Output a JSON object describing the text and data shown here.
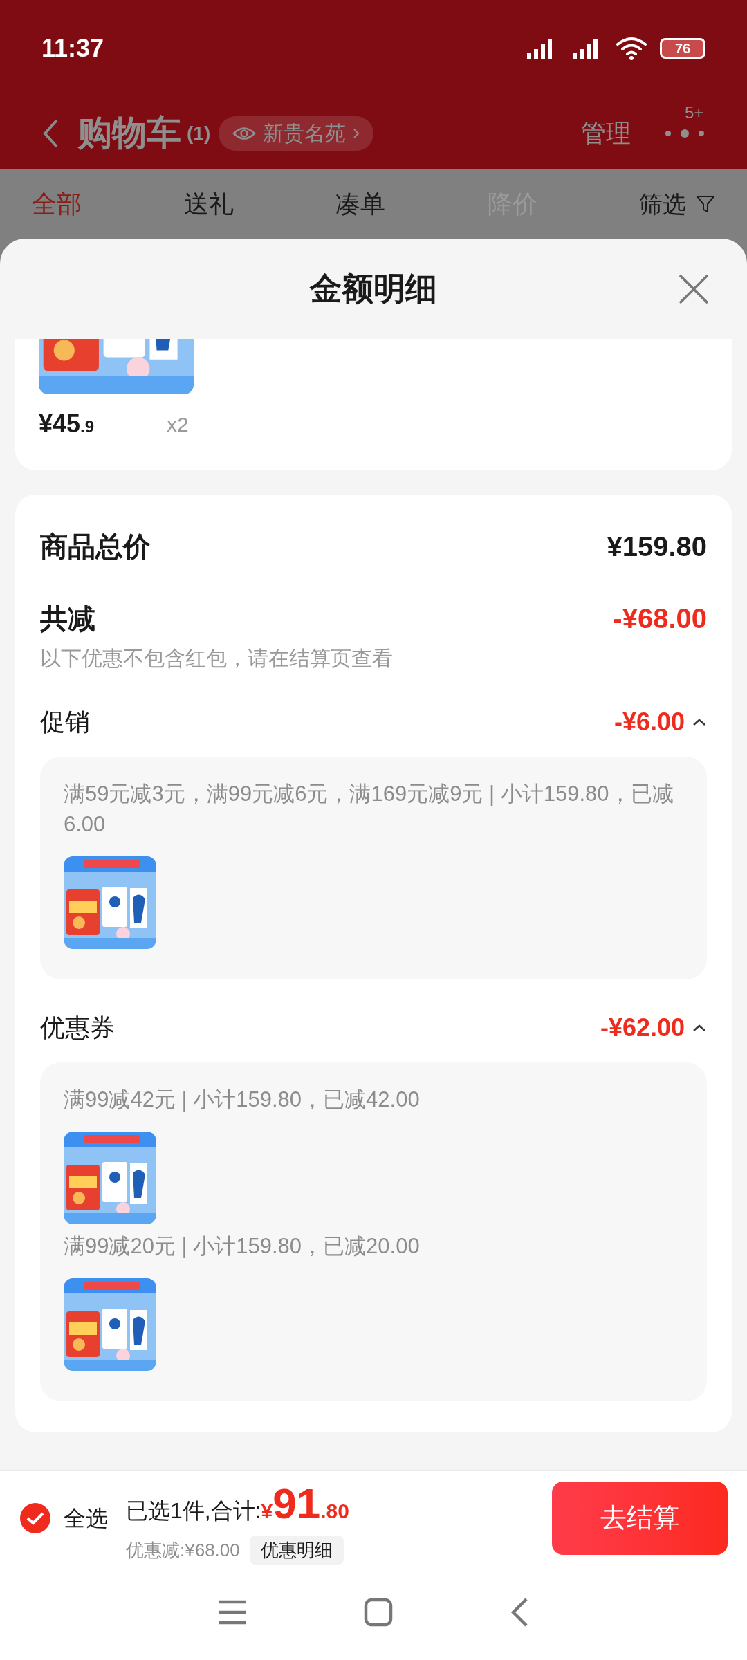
{
  "status_bar": {
    "time": "11:37",
    "battery": "76"
  },
  "header": {
    "title": "购物车",
    "count": "(1)",
    "store_chip": "新贵名苑",
    "manage": "管理",
    "badge": "5+"
  },
  "tabs": [
    {
      "label": "全部",
      "selected": true,
      "disabled": false
    },
    {
      "label": "送礼",
      "selected": false,
      "disabled": false
    },
    {
      "label": "凑单",
      "selected": false,
      "disabled": false
    },
    {
      "label": "降价",
      "selected": false,
      "disabled": true
    }
  ],
  "filter": {
    "label": "筛选"
  },
  "sheet": {
    "title": "金额明细"
  },
  "product": {
    "price": "¥45",
    "price_decimal": ".9",
    "quantity": "x2"
  },
  "summary": {
    "total_label": "商品总价",
    "total_value": "¥159.80",
    "discount_label": "共减",
    "discount_value": "-¥68.00",
    "note": "以下优惠不包含红包，请在结算页查看"
  },
  "sections": [
    {
      "label": "促销",
      "amount": "-¥6.00",
      "expanded": true,
      "groups": [
        {
          "text": "满59元减3元，满99元减6元，满169元减9元 | 小计159.80，已减6.00"
        }
      ]
    },
    {
      "label": "优惠券",
      "amount": "-¥62.00",
      "expanded": true,
      "groups": [
        {
          "text": "满99减42元 | 小计159.80，已减42.00"
        },
        {
          "text": "满99减20元 | 小计159.80，已减20.00"
        }
      ]
    }
  ],
  "bottom_bar": {
    "select_all": {
      "label": "全选",
      "checked": true
    },
    "selected_summary": "已选1件,合计:",
    "currency": "¥",
    "integer": "91",
    "decimal": ".80",
    "saving": "优惠减:¥68.00",
    "detail_button": "优惠明细",
    "checkout": "去结算"
  }
}
